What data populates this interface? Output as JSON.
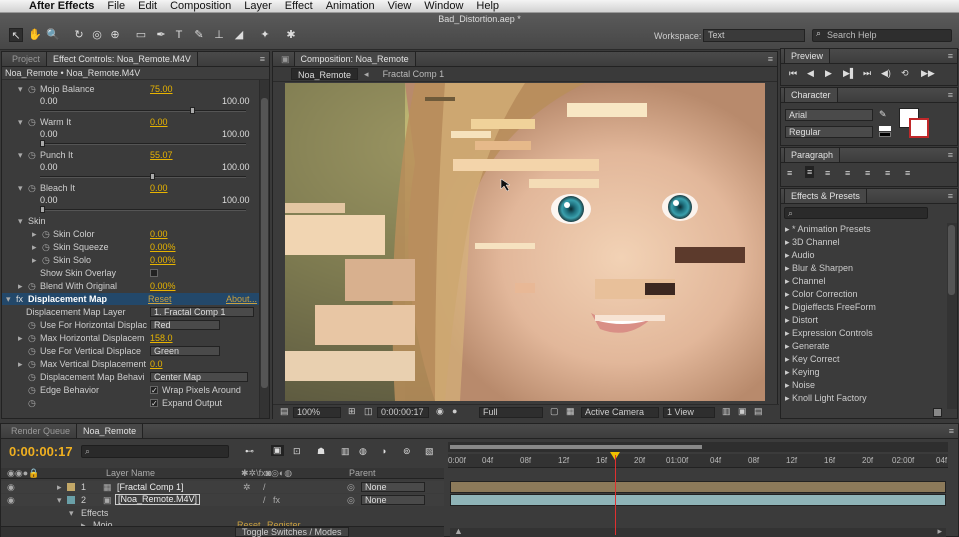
{
  "menubar": {
    "app": "After Effects",
    "items": [
      "File",
      "Edit",
      "Composition",
      "Layer",
      "Effect",
      "Animation",
      "View",
      "Window",
      "Help"
    ]
  },
  "window": {
    "title": "Bad_Distortion.aep *"
  },
  "toolbar": {
    "workspace_label": "Workspace:",
    "workspace_value": "Text",
    "search_placeholder": "Search Help"
  },
  "left_panel": {
    "tab_project": "Project",
    "tab_fx": "Effect Controls: Noa_Remote.M4V",
    "header": "Noa_Remote • Noa_Remote.M4V"
  },
  "fx": {
    "mojo_balance": {
      "label": "Mojo Balance",
      "value": "75.00",
      "min": "0.00",
      "max": "100.00",
      "level": 0.75
    },
    "warm_it": {
      "label": "Warm It",
      "value": "0.00",
      "min": "0.00",
      "max": "100.00",
      "level": 0.0
    },
    "punch_it": {
      "label": "Punch It",
      "value": "55.07",
      "min": "0.00",
      "max": "100.00",
      "level": 0.55
    },
    "bleach_it": {
      "label": "Bleach It",
      "value": "0.00",
      "min": "0.00",
      "max": "100.00",
      "level": 0.0
    },
    "skin": "Skin",
    "skin_color": {
      "label": "Skin Color",
      "value": "0.00"
    },
    "skin_squeeze": {
      "label": "Skin Squeeze",
      "value": "0.00%"
    },
    "skin_solo": {
      "label": "Skin Solo",
      "value": "0.00%"
    },
    "show_skin_overlay": "Show Skin Overlay",
    "blend_with_original": {
      "label": "Blend With Original",
      "value": "0.00%"
    },
    "displacement_map": {
      "label": "Displacement Map",
      "reset": "Reset",
      "about": "About..."
    },
    "disp_layer": {
      "label": "Displacement Map Layer",
      "value": "1. Fractal Comp 1"
    },
    "use_h": {
      "label": "Use For Horizontal Displac",
      "value": "Red"
    },
    "max_h": {
      "label": "Max Horizontal Displacem",
      "value": "158.0"
    },
    "use_v": {
      "label": "Use For Vertical Displace",
      "value": "Green"
    },
    "max_v": {
      "label": "Max Vertical Displacement",
      "value": "0.0"
    },
    "map_behavior": {
      "label": "Displacement Map Behavi",
      "value": "Center Map"
    },
    "edge_behavior": {
      "label": "Edge Behavior",
      "value": "Wrap Pixels Around"
    },
    "expand_output": {
      "value": "Expand Output"
    }
  },
  "comp": {
    "tab": "Composition: Noa_Remote",
    "crumb_active": "Noa_Remote",
    "crumb_next": "Fractal Comp 1",
    "footer": {
      "zoom": "100%",
      "timecode": "0:00:00:17",
      "resolution": "Full",
      "camera": "Active Camera",
      "view": "1 View"
    }
  },
  "preview": {
    "tab": "Preview"
  },
  "character": {
    "tab": "Character",
    "font": "Arial",
    "style": "Regular"
  },
  "paragraph": {
    "tab": "Paragraph"
  },
  "presets": {
    "tab": "Effects & Presets",
    "items": [
      "* Animation Presets",
      "3D Channel",
      "Audio",
      "Blur & Sharpen",
      "Channel",
      "Color Correction",
      "Digieffects FreeForm",
      "Distort",
      "Expression Controls",
      "Generate",
      "Key Correct",
      "Keying",
      "Noise",
      "Knoll Light Factory"
    ]
  },
  "timeline": {
    "tab_render": "Render Queue",
    "tab_comp": "Noa_Remote",
    "timecode": "0:00:00:17",
    "col_layer_name": "Layer Name",
    "col_parent": "Parent",
    "layers": [
      {
        "num": "1",
        "name": "[Fractal Comp 1]",
        "parent": "None"
      },
      {
        "num": "2",
        "name": "[Noa_Remote.M4V]",
        "parent": "None"
      }
    ],
    "effects": "Effects",
    "mojo": "Mojo",
    "reset": "Reset",
    "register": "Register",
    "toggle": "Toggle Switches / Modes",
    "ruler": [
      "0:00f",
      "04f",
      "08f",
      "12f",
      "16f",
      "20f",
      "01:00f",
      "04f",
      "08f",
      "12f",
      "16f",
      "20f",
      "02:00f",
      "04f"
    ]
  },
  "colors": {
    "accent_value": "#e8b400",
    "cti": "#e03030"
  }
}
